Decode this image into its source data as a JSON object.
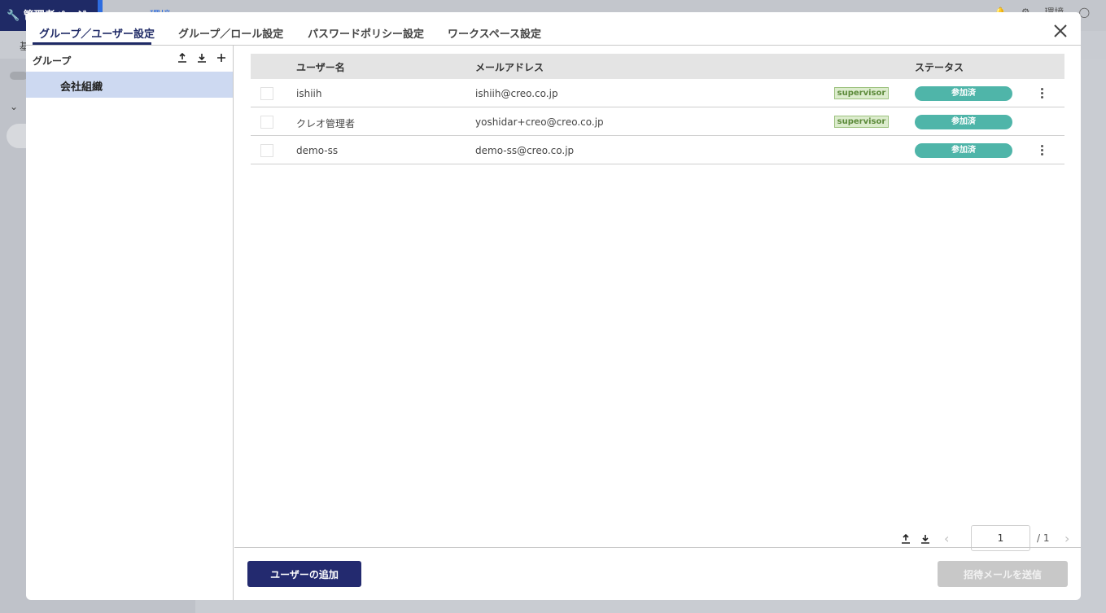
{
  "background": {
    "brand": "🔧 管理者ページ",
    "topbar_text": "環境",
    "subbar_text": "基",
    "user_label": "環境"
  },
  "tabs": [
    {
      "label": "グループ／ユーザー設定",
      "active": true
    },
    {
      "label": "グループ／ロール設定"
    },
    {
      "label": "パスワードポリシー設定"
    },
    {
      "label": "ワークスペース設定"
    }
  ],
  "groups": {
    "header": "グループ",
    "items": [
      {
        "label": "会社組織"
      }
    ]
  },
  "table": {
    "columns": {
      "username": "ユーザー名",
      "email": "メールアドレス",
      "status": "ステータス"
    },
    "rows": [
      {
        "username": "ishiih",
        "email": "ishiih@creo.co.jp",
        "role": "supervisor",
        "status": "参加済"
      },
      {
        "username": "クレオ管理者",
        "email": "yoshidar+creo@creo.co.jp",
        "role": "supervisor",
        "status": "参加済"
      },
      {
        "username": "demo-ss",
        "email": "demo-ss@creo.co.jp",
        "role": "",
        "status": "参加済"
      }
    ]
  },
  "pager": {
    "current": "1",
    "total": "/ 1"
  },
  "footer": {
    "add_user": "ユーザーの追加",
    "send_invite": "招待メールを送信"
  },
  "colors": {
    "primary": "#232a6f",
    "status": "#4fb5a9",
    "selected": "#cdd9f1",
    "badge_bg": "#dceccd"
  }
}
